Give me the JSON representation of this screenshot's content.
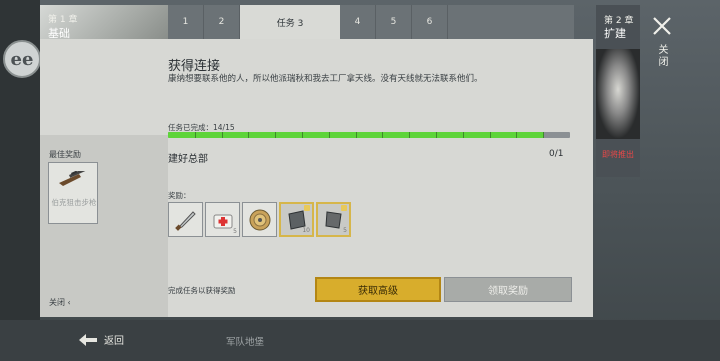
{
  "chapters": {
    "current": {
      "number": "第 1 章",
      "name": "基础"
    },
    "next": {
      "number": "第 2 章",
      "name": "扩建",
      "tag": "即将推出"
    }
  },
  "tabs": [
    "1",
    "2",
    "任务 3",
    "4",
    "5",
    "6"
  ],
  "active_tab_index": 2,
  "quest": {
    "title": "获得连接",
    "description": "康纳想要联系他的人，所以他派瑞秋和我去工厂拿天线。没有天线就无法联系他们。",
    "progress_label": "任务已完成：",
    "progress_value": "14/15",
    "progress_fraction": 0.9333
  },
  "objective": {
    "title": "建好总部",
    "count": "0/1"
  },
  "rewards": {
    "label": "奖励：",
    "items": [
      {
        "icon": "machete-icon",
        "quantity": "",
        "locked": false
      },
      {
        "icon": "medkit-icon",
        "quantity": "5",
        "locked": false
      },
      {
        "icon": "cable-spool-icon",
        "quantity": "",
        "locked": false
      },
      {
        "icon": "metal-plate-icon",
        "quantity": "10",
        "locked": true
      },
      {
        "icon": "metal-sheet-icon",
        "quantity": "5",
        "locked": true
      }
    ]
  },
  "best_reward": {
    "label": "最佳奖励",
    "item_name": "伯克狙击步枪"
  },
  "close_left": "关闭 ‹",
  "hint": "完成任务以获得奖励",
  "buttons": {
    "premium": "获取高级",
    "claim": "领取奖励"
  },
  "close_label": "关闭",
  "bottom": {
    "back": "返回",
    "army_base": "军队地堡"
  },
  "colors": {
    "accent_gold": "#d8ad2c",
    "progress_green": "#5ed43a",
    "coming_soon_red": "#e84848"
  }
}
